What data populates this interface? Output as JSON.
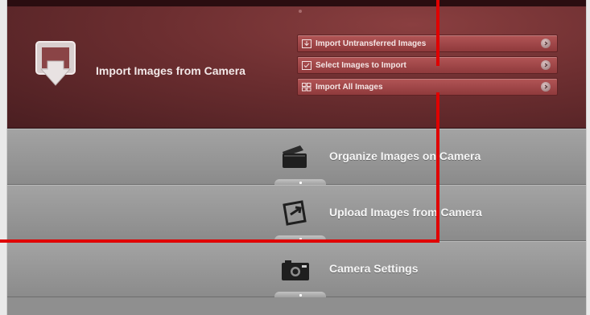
{
  "import_section": {
    "title": "Import Images from Camera",
    "options": [
      {
        "label": "Import Untransferred Images",
        "icon": "import-untransferred-icon"
      },
      {
        "label": "Select Images to Import",
        "icon": "select-images-icon"
      },
      {
        "label": "Import All Images",
        "icon": "import-all-icon"
      }
    ]
  },
  "menu_rows": [
    {
      "label": "Organize Images on Camera",
      "icon": "organize-folder-icon"
    },
    {
      "label": "Upload Images from Camera",
      "icon": "upload-web-icon"
    },
    {
      "label": "Camera Settings",
      "icon": "camera-icon"
    }
  ],
  "colors": {
    "callout": "#e00000",
    "import_panel": "#6c2e30",
    "option_button": "#a24a4c",
    "row_gray": "#969696"
  }
}
